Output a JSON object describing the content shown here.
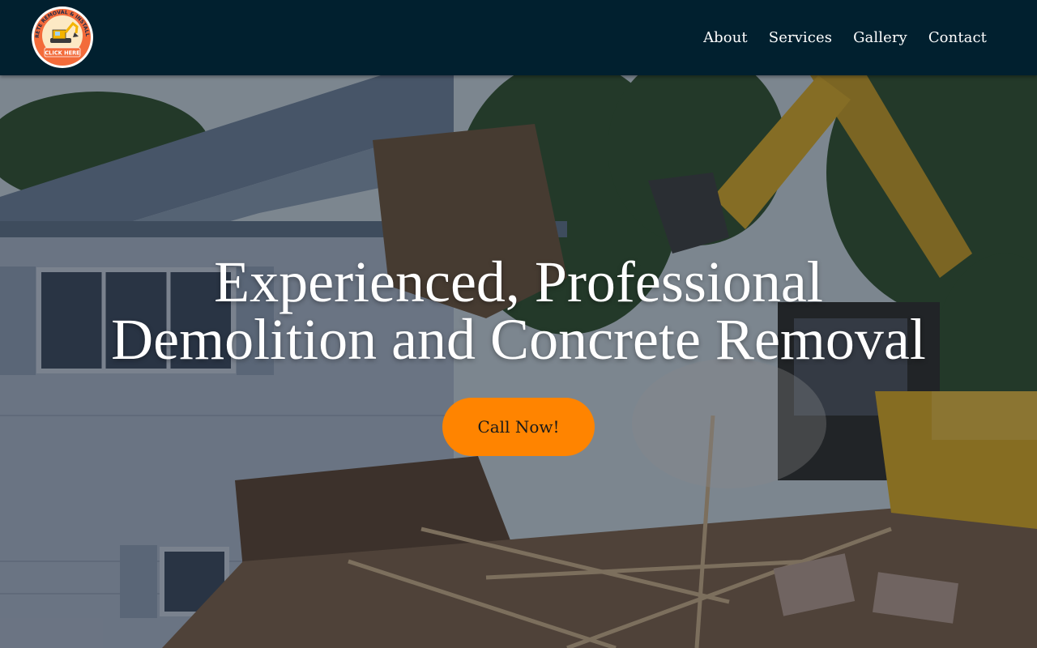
{
  "header": {
    "logo": {
      "ring_text": "CONCRETE REMOVAL & INSTALLATION",
      "banner_text": "CLICK HERE",
      "colors": {
        "ring": "#f36b3a",
        "inner": "#fce9c4",
        "banner": "#f36b3a",
        "machine": "#f4b400"
      }
    },
    "nav": [
      {
        "label": "About"
      },
      {
        "label": "Services"
      },
      {
        "label": "Gallery"
      },
      {
        "label": "Contact"
      }
    ],
    "background": "#01202f"
  },
  "hero": {
    "headline_line1": "Experienced, Professional",
    "headline_line2": "Demolition and Concrete Removal",
    "cta_label": "Call Now!",
    "cta_color": "#ff8400",
    "background_image": "house-demolition-with-excavator"
  }
}
